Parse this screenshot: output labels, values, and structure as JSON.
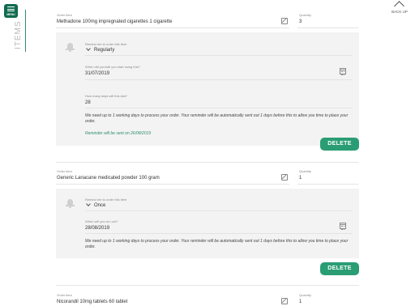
{
  "nav": {
    "menu_label": "MENU",
    "section_title": "ITEMS",
    "back_up_label": "BACK UP"
  },
  "orders": [
    {
      "item_label": "Order item",
      "item_name": "Methadone 100mg impregnated cigarettes 1 cigarette",
      "quantity_label": "Quantity",
      "quantity": "3",
      "remind_label": "Remind me to order this item",
      "remind_value": "Regularly",
      "start_label": "When did you/will you start using this?",
      "start_value": "31/07/2019",
      "days_label": "How many days will this last?",
      "days_value": "28",
      "notice": "We need up to 1 working days to process your order. Your reminder will be automatically sent out 1 days before this to allow you time to place your order.",
      "reminder_text": "Reminder will be sent on 26/08/2019",
      "delete_label": "DELETE"
    },
    {
      "item_label": "Order item",
      "item_name": "Generic Lanacane medicated powder 100 gram",
      "quantity_label": "Quantity",
      "quantity": "1",
      "remind_label": "Remind me to order this item",
      "remind_value": "Once",
      "runout_label": "When will you run out?",
      "runout_value": "28/08/2019",
      "notice": "We need up to 1 working days to process your order. Your reminder will be automatically sent out 1 days before this to allow you time to place your order.",
      "delete_label": "DELETE"
    },
    {
      "item_label": "Order item",
      "item_name": "Nicorandil 10mg tablets 60 tablet",
      "quantity_label": "Quantity",
      "quantity": "1"
    }
  ]
}
